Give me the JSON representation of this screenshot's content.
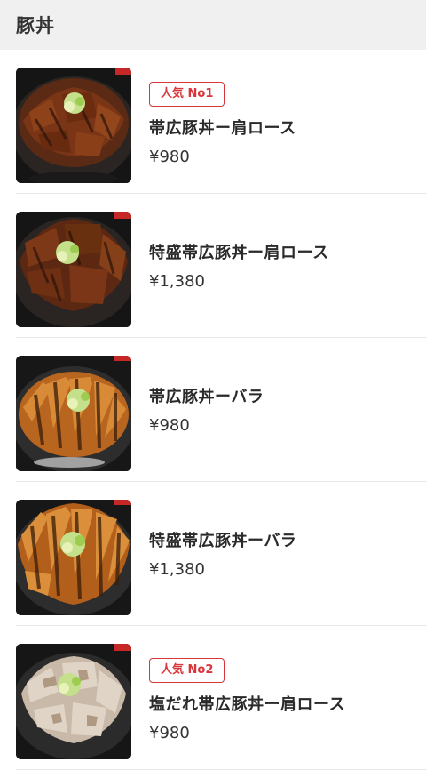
{
  "header": {
    "title": "豚丼"
  },
  "items": [
    {
      "name": "帯広豚丼ー肩ロース",
      "price": "¥980",
      "badge": "人気 No1",
      "image": "pork-loin-bowl-photo"
    },
    {
      "name": "特盛帯広豚丼ー肩ロース",
      "price": "¥1,380",
      "badge": "",
      "image": "large-pork-loin-bowl-photo"
    },
    {
      "name": "帯広豚丼ーバラ",
      "price": "¥980",
      "badge": "",
      "image": "pork-belly-bowl-photo"
    },
    {
      "name": "特盛帯広豚丼ーバラ",
      "price": "¥1,380",
      "badge": "",
      "image": "large-pork-belly-bowl-photo"
    },
    {
      "name": "塩だれ帯広豚丼ー肩ロース",
      "price": "¥980",
      "badge": "人気 No2",
      "image": "salt-sauce-pork-bowl-photo"
    }
  ],
  "colors": {
    "accent": "#d9353a",
    "header_bg": "#f0f0f0",
    "divider": "#e6e6e6"
  }
}
